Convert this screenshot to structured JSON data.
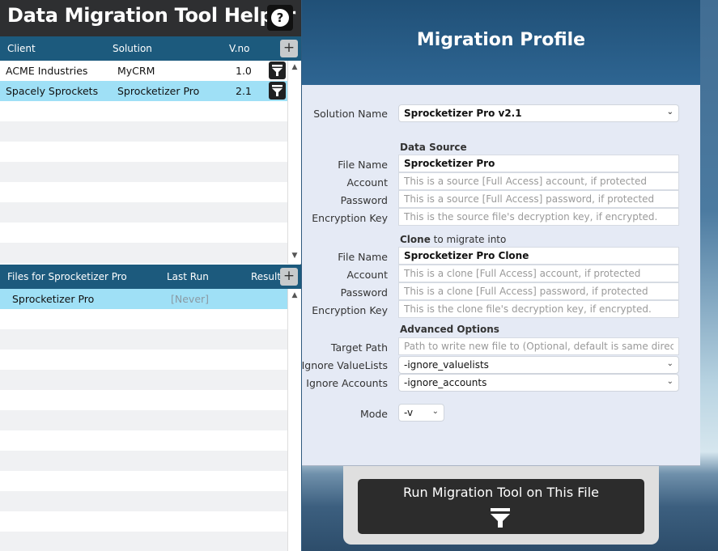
{
  "app": {
    "title": "Data Migration Tool Helper",
    "help_glyph": "?"
  },
  "clients": {
    "headers": {
      "client": "Client",
      "solution": "Solution",
      "version": "V.no"
    },
    "add_glyph": "+",
    "rows": [
      {
        "client": "ACME Industries",
        "solution": "MyCRM",
        "version": "1.0",
        "selected": false
      },
      {
        "client": "Spacely Sprockets",
        "solution": "Sprocketizer Pro",
        "version": "2.1",
        "selected": true
      }
    ]
  },
  "files": {
    "headers": {
      "files_for": "Files for",
      "solution": "Sprocketizer Pro",
      "last_run": "Last Run",
      "result": "Result"
    },
    "add_glyph": "+",
    "rows": [
      {
        "name": "Sprocketizer Pro",
        "last_run": "[Never]",
        "result": "",
        "selected": true
      }
    ]
  },
  "profile": {
    "title": "Migration Profile",
    "solution_name_label": "Solution Name",
    "solution_name_value": "Sprocketizer Pro v2.1",
    "data_source": {
      "section": "Data Source",
      "file_name_label": "File Name",
      "file_name_value": "Sprocketizer Pro",
      "account_label": "Account",
      "account_placeholder": "This is a source [Full Access] account, if protected",
      "password_label": "Password",
      "password_placeholder": "This is a source [Full Access] password, if protected",
      "encryption_label": "Encryption Key",
      "encryption_placeholder": "This is the source file's decryption key, if encrypted."
    },
    "clone": {
      "section_bold": "Clone",
      "section_rest": " to migrate into",
      "file_name_label": "File Name",
      "file_name_value": "Sprocketizer Pro Clone",
      "account_label": "Account",
      "account_placeholder": "This is a clone [Full Access] account, if protected",
      "password_label": "Password",
      "password_placeholder": "This is a clone [Full Access] password, if protected",
      "encryption_label": "Encryption Key",
      "encryption_placeholder": "This is the clone file's decryption key, if encrypted."
    },
    "advanced": {
      "section": "Advanced Options",
      "target_path_label": "Target Path",
      "target_path_placeholder": "Path to write new file to (Optional, default is same directory)",
      "ignore_valuelists_label": "Ignore ValueLists",
      "ignore_valuelists_value": "-ignore_valuelists",
      "ignore_accounts_label": "Ignore Accounts",
      "ignore_accounts_value": "-ignore_accounts"
    },
    "mode_label": "Mode",
    "mode_value": "-v"
  },
  "run": {
    "label": "Run Migration Tool on This File",
    "icon": "funnel-icon"
  },
  "colors": {
    "header_dark": "#2e2f31",
    "list_header": "#1c5a7d",
    "selected_row": "#9fe0f6",
    "profile_bg": "#e5eaf5",
    "run_button": "#2c2c2c"
  }
}
